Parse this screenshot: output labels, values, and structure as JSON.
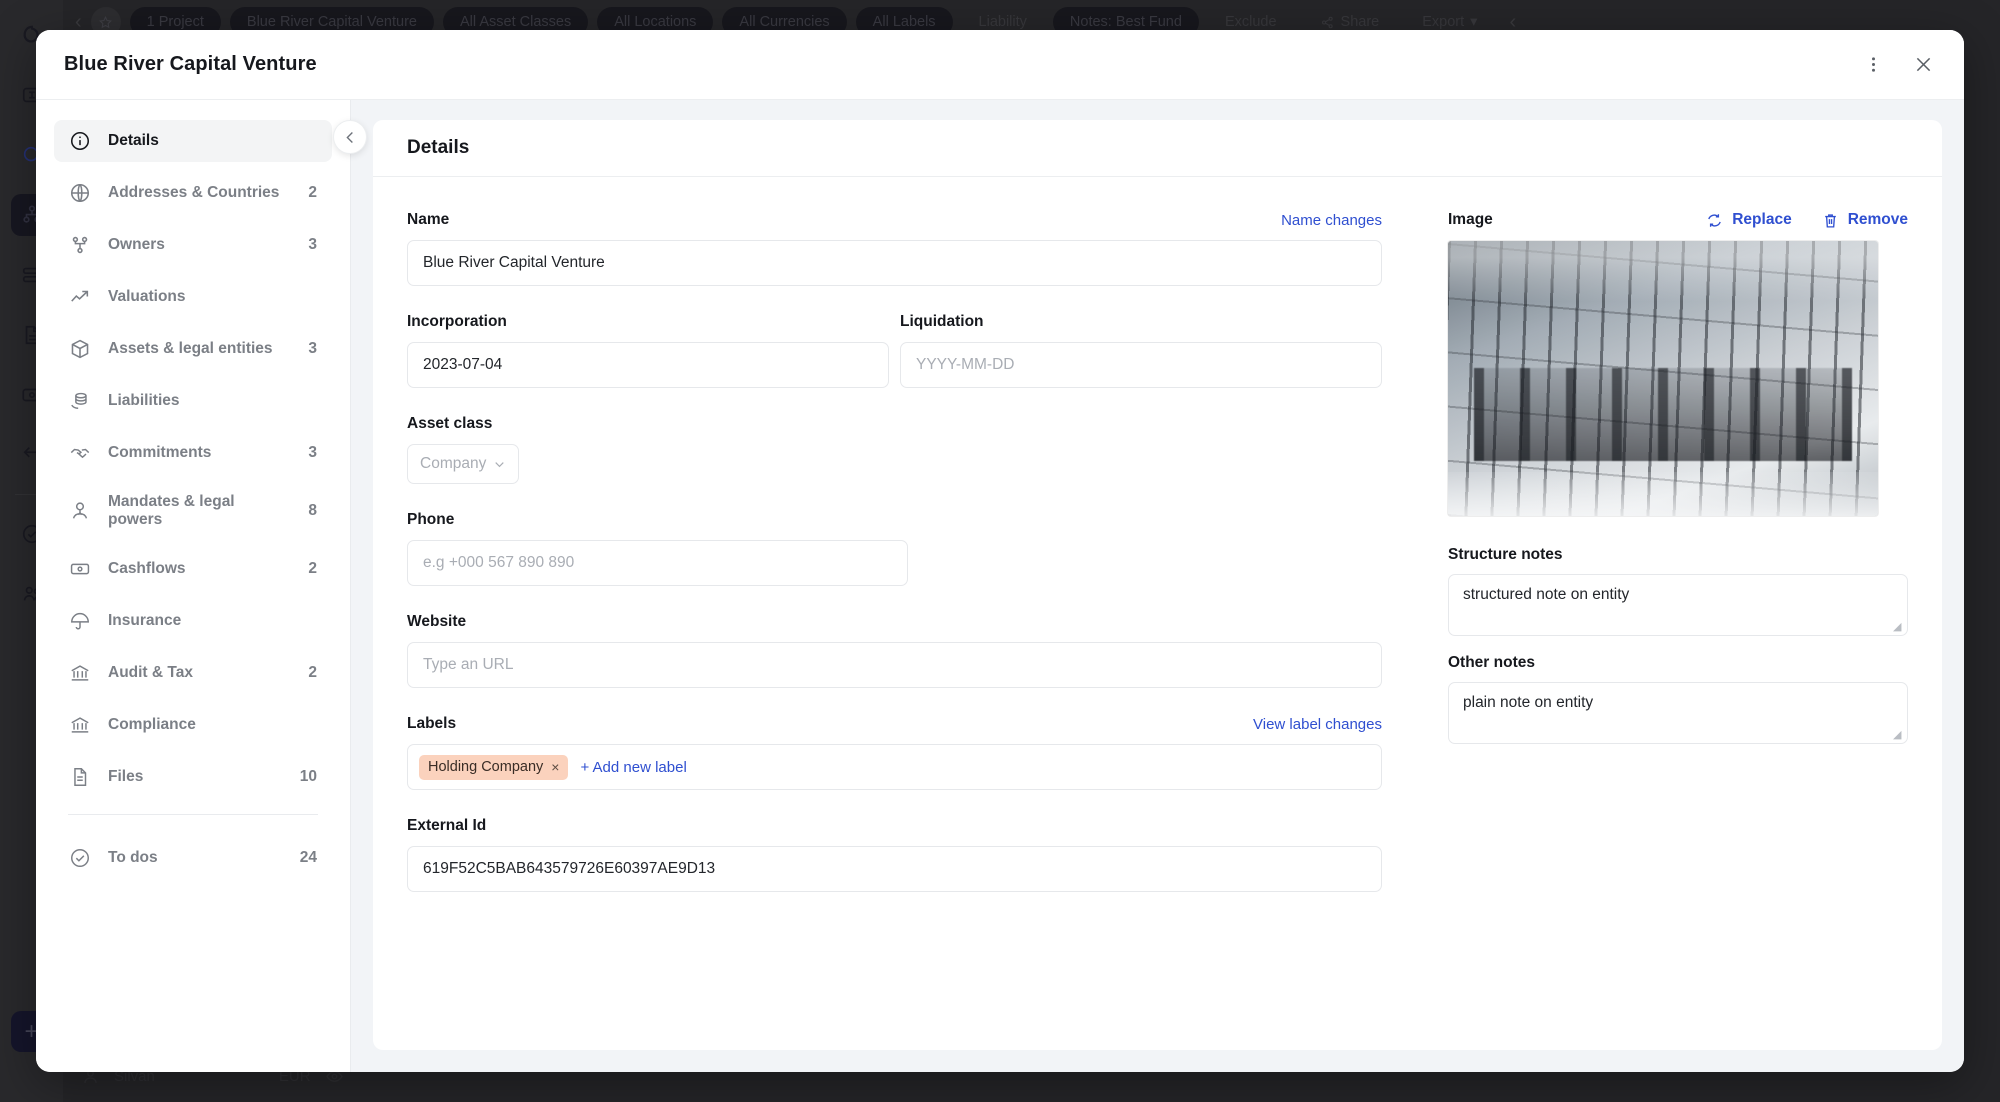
{
  "background": {
    "topbar_chips": [
      {
        "label": "1 Project",
        "style": "solid"
      },
      {
        "label": "Blue River Capital Venture",
        "style": "solid"
      },
      {
        "label": "All Asset Classes",
        "style": "solid"
      },
      {
        "label": "All Locations",
        "style": "solid"
      },
      {
        "label": "All Currencies",
        "style": "solid"
      },
      {
        "label": "All Labels",
        "style": "solid"
      },
      {
        "label": "Liability",
        "style": "plain"
      },
      {
        "label": "Notes: Best Fund",
        "style": "solid"
      },
      {
        "label": "Exclude",
        "style": "plain"
      },
      {
        "label": "Share",
        "style": "plain"
      },
      {
        "label": "Export",
        "style": "plain"
      }
    ],
    "bottombar": {
      "user": "Silvan",
      "currency": "EUR"
    }
  },
  "modal": {
    "title": "Blue River Capital Venture",
    "more_menu": "more-options",
    "close": "close"
  },
  "sidebar": {
    "items": [
      {
        "label": "Details",
        "count": "",
        "icon": "info-icon",
        "active": true
      },
      {
        "label": "Addresses & Countries",
        "count": "2",
        "icon": "globe-icon",
        "active": false
      },
      {
        "label": "Owners",
        "count": "3",
        "icon": "hierarchy-icon",
        "active": false
      },
      {
        "label": "Valuations",
        "count": "",
        "icon": "trend-up-icon",
        "active": false
      },
      {
        "label": "Assets & legal entities",
        "count": "3",
        "icon": "box-icon",
        "active": false
      },
      {
        "label": "Liabilities",
        "count": "",
        "icon": "coins-icon",
        "active": false
      },
      {
        "label": "Commitments",
        "count": "3",
        "icon": "handshake-icon",
        "active": false
      },
      {
        "label": "Mandates & legal powers",
        "count": "8",
        "icon": "person-badge-icon",
        "active": false
      },
      {
        "label": "Cashflows",
        "count": "2",
        "icon": "banknote-icon",
        "active": false
      },
      {
        "label": "Insurance",
        "count": "",
        "icon": "umbrella-icon",
        "active": false
      },
      {
        "label": "Audit & Tax",
        "count": "2",
        "icon": "bank-icon",
        "active": false
      },
      {
        "label": "Compliance",
        "count": "",
        "icon": "bank-icon",
        "active": false
      },
      {
        "label": "Files",
        "count": "10",
        "icon": "file-icon",
        "active": false
      }
    ],
    "footer_items": [
      {
        "label": "To dos",
        "count": "24",
        "icon": "check-circle-icon",
        "active": false
      }
    ]
  },
  "content": {
    "heading": "Details",
    "name": {
      "label": "Name",
      "link": "Name changes",
      "value": "Blue River Capital Venture"
    },
    "incorporation": {
      "label": "Incorporation",
      "value": "2023-07-04"
    },
    "liquidation": {
      "label": "Liquidation",
      "value": "",
      "placeholder": "YYYY-MM-DD"
    },
    "asset_class": {
      "label": "Asset class",
      "value": "Company"
    },
    "phone": {
      "label": "Phone",
      "value": "",
      "placeholder": "e.g +000 567 890 890"
    },
    "website": {
      "label": "Website",
      "value": "",
      "placeholder": "Type an URL"
    },
    "labels": {
      "label": "Labels",
      "link": "View label changes",
      "tags": [
        {
          "text": "Holding Company",
          "remove": "×",
          "color": "#fbd2bd"
        }
      ],
      "add": "+ Add new label"
    },
    "external_id": {
      "label": "External Id",
      "value": "619F52C5BAB643579726E60397AE9D13"
    },
    "image": {
      "label": "Image",
      "replace": "Replace",
      "remove": "Remove",
      "alt": "office-meeting-room-photo"
    },
    "structure_notes": {
      "label": "Structure notes",
      "value": "structured note on entity"
    },
    "other_notes": {
      "label": "Other notes",
      "value": "plain note on entity"
    }
  },
  "colors": {
    "link": "#2f4fd0",
    "tag": "#fbd2bd",
    "active_nav_bg": "#f3f4f5"
  }
}
